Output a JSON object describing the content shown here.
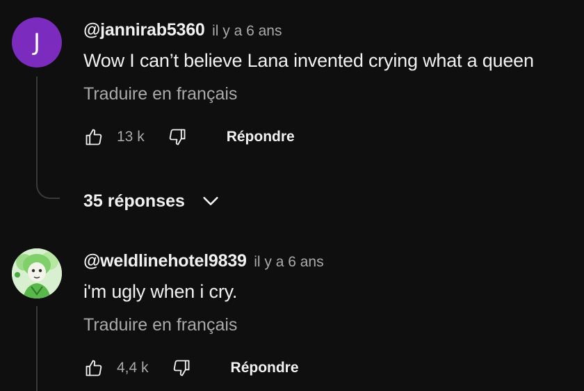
{
  "comments": [
    {
      "avatar_letter": "J",
      "avatar_color": "#7b2cbf",
      "handle": "@jannirab5360",
      "time": "il y a 6 ans",
      "text": "Wow I can’t believe Lana invented crying what a queen",
      "translate_label": "Traduire en français",
      "likes": "13 k",
      "reply_label": "Répondre",
      "replies_label": "35 réponses"
    },
    {
      "avatar_style": "green-illustrated-avatar",
      "handle": "@weldlinehotel9839",
      "time": "il y a 6 ans",
      "text": "i'm ugly when i cry.",
      "translate_label": "Traduire en français",
      "likes": "4,4 k",
      "reply_label": "Répondre"
    }
  ],
  "icons": {
    "like": "thumbs-up-icon",
    "dislike": "thumbs-down-icon",
    "expand": "chevron-down-icon"
  },
  "colors": {
    "background": "#0f0f0f",
    "primary_text": "#f1f1f1",
    "secondary_text": "#aaaaaa",
    "thread_line": "#3a3a3a"
  }
}
